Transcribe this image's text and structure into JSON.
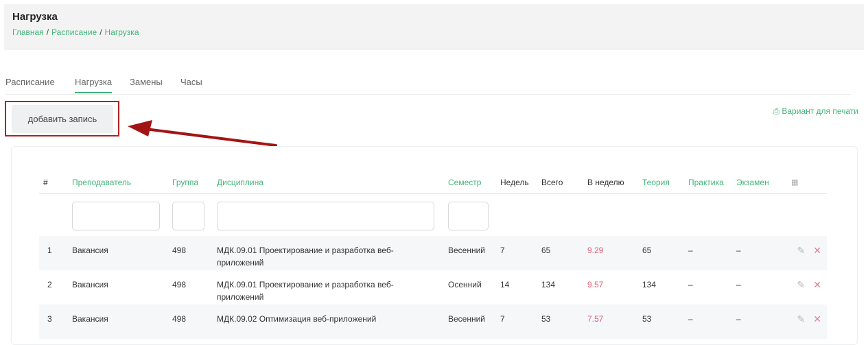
{
  "header": {
    "title": "Нагрузка",
    "breadcrumb": [
      "Главная",
      "Расписание",
      "Нагрузка"
    ],
    "breadcrumb_sep": "/"
  },
  "tabs": [
    {
      "label": "Расписание",
      "active": false
    },
    {
      "label": "Нагрузка",
      "active": true
    },
    {
      "label": "Замены",
      "active": false
    },
    {
      "label": "Часы",
      "active": false
    }
  ],
  "toolbar": {
    "add_label": "добавить запись",
    "print_label": "Вариант для печати"
  },
  "table": {
    "columns": [
      "#",
      "Преподаватель",
      "Группа",
      "Дисциплина",
      "Семестр",
      "Недель",
      "Всего",
      "В неделю",
      "Теория",
      "Практика",
      "Экзамен"
    ],
    "rows": [
      {
        "num": "1",
        "teacher": "Вакансия",
        "group": "498",
        "discipline": "МДК.09.01 Проектирование и разработка веб-приложений",
        "semester": "Весенний",
        "weeks": "7",
        "total": "65",
        "per_week": "9.29",
        "theory": "65",
        "practice": "–",
        "exam": "–"
      },
      {
        "num": "2",
        "teacher": "Вакансия",
        "group": "498",
        "discipline": "МДК.09.01 Проектирование и разработка веб-приложений",
        "semester": "Осенний",
        "weeks": "14",
        "total": "134",
        "per_week": "9.57",
        "theory": "134",
        "practice": "–",
        "exam": "–"
      },
      {
        "num": "3",
        "teacher": "Вакансия",
        "group": "498",
        "discipline": "МДК.09.02 Оптимизация веб-приложений",
        "semester": "Весенний",
        "weeks": "7",
        "total": "53",
        "per_week": "7.57",
        "theory": "53",
        "practice": "–",
        "exam": "–"
      }
    ]
  },
  "colors": {
    "accent": "#43b47a",
    "highlight_box": "#b22222",
    "per_week_value": "#e0627a"
  }
}
